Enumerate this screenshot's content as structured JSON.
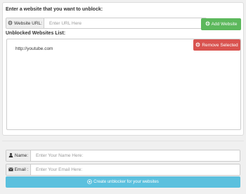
{
  "unblock_form": {
    "heading": "Enter a website that you want to unblock:",
    "url_addon_label": "Website URL:",
    "url_placeholder": "Enter URL Here",
    "url_value": "",
    "add_button_label": "Add Website",
    "list_heading": "Unblocked Websites List:",
    "remove_button_label": "Remove Selected",
    "websites": [
      "http://youtube.com"
    ]
  },
  "user_form": {
    "name_addon_label": "Name:",
    "name_placeholder": "Enter Your Name Here:",
    "email_addon_label": "Email :",
    "email_placeholder": "Enter Your Email Here:",
    "create_button_label": "Create unblocker for your websites"
  },
  "colors": {
    "add_button": "#5cb85c",
    "remove_button": "#d9534f",
    "create_button": "#5bc0de"
  },
  "icons": {
    "url_addon": "globe-icon",
    "add_button": "globe-icon",
    "remove_button": "globe-icon",
    "name_addon": "user-icon",
    "email_addon": "envelope-icon",
    "create_button": "plus-circle-icon"
  }
}
